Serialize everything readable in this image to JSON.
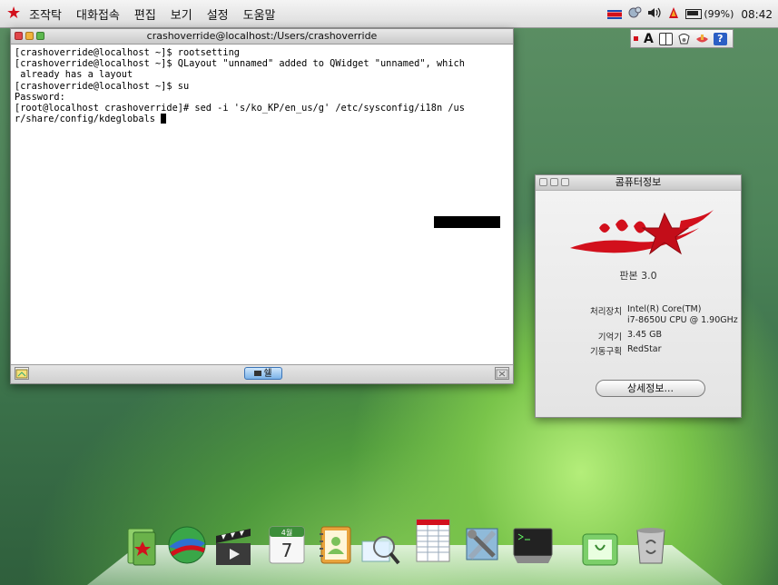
{
  "menubar": {
    "items": [
      "조작탁",
      "대화접속",
      "편집",
      "보기",
      "설정",
      "도움말"
    ],
    "battery": "(99%)",
    "clock": "08:42"
  },
  "ime": {
    "mode": "A"
  },
  "terminal": {
    "title": "crashoverride@localhost:/Users/crashoverride",
    "lines": [
      "[crashoverride@localhost ~]$ rootsetting",
      "[crashoverride@localhost ~]$ QLayout \"unnamed\" added to QWidget \"unnamed\", which",
      " already has a layout",
      "",
      "[crashoverride@localhost ~]$ su",
      "Password:",
      "[root@localhost crashoverride]# sed -i 's/ko_KP/en_us/g' /etc/sysconfig/i18n /us",
      "r/share/config/kdeglobals "
    ],
    "tab_label": "쉘"
  },
  "about": {
    "title": "콤퓨터정보",
    "version": "판본 3.0",
    "cpu_label": "처리장치",
    "cpu_value_1": "Intel(R) Core(TM)",
    "cpu_value_2": "i7-8650U CPU @ 1.90GHz",
    "memory_label": "기억기",
    "memory_value": "3.45 GB",
    "os_label": "기동구획",
    "os_value": "RedStar",
    "details_button": "상세정보..."
  },
  "dock": {
    "calendar_month": "4월",
    "calendar_day": "7"
  },
  "colors": {
    "accent_red": "#d2101c",
    "menubar": "#e6e6e6",
    "shell_tab": "#7ab2e8"
  }
}
